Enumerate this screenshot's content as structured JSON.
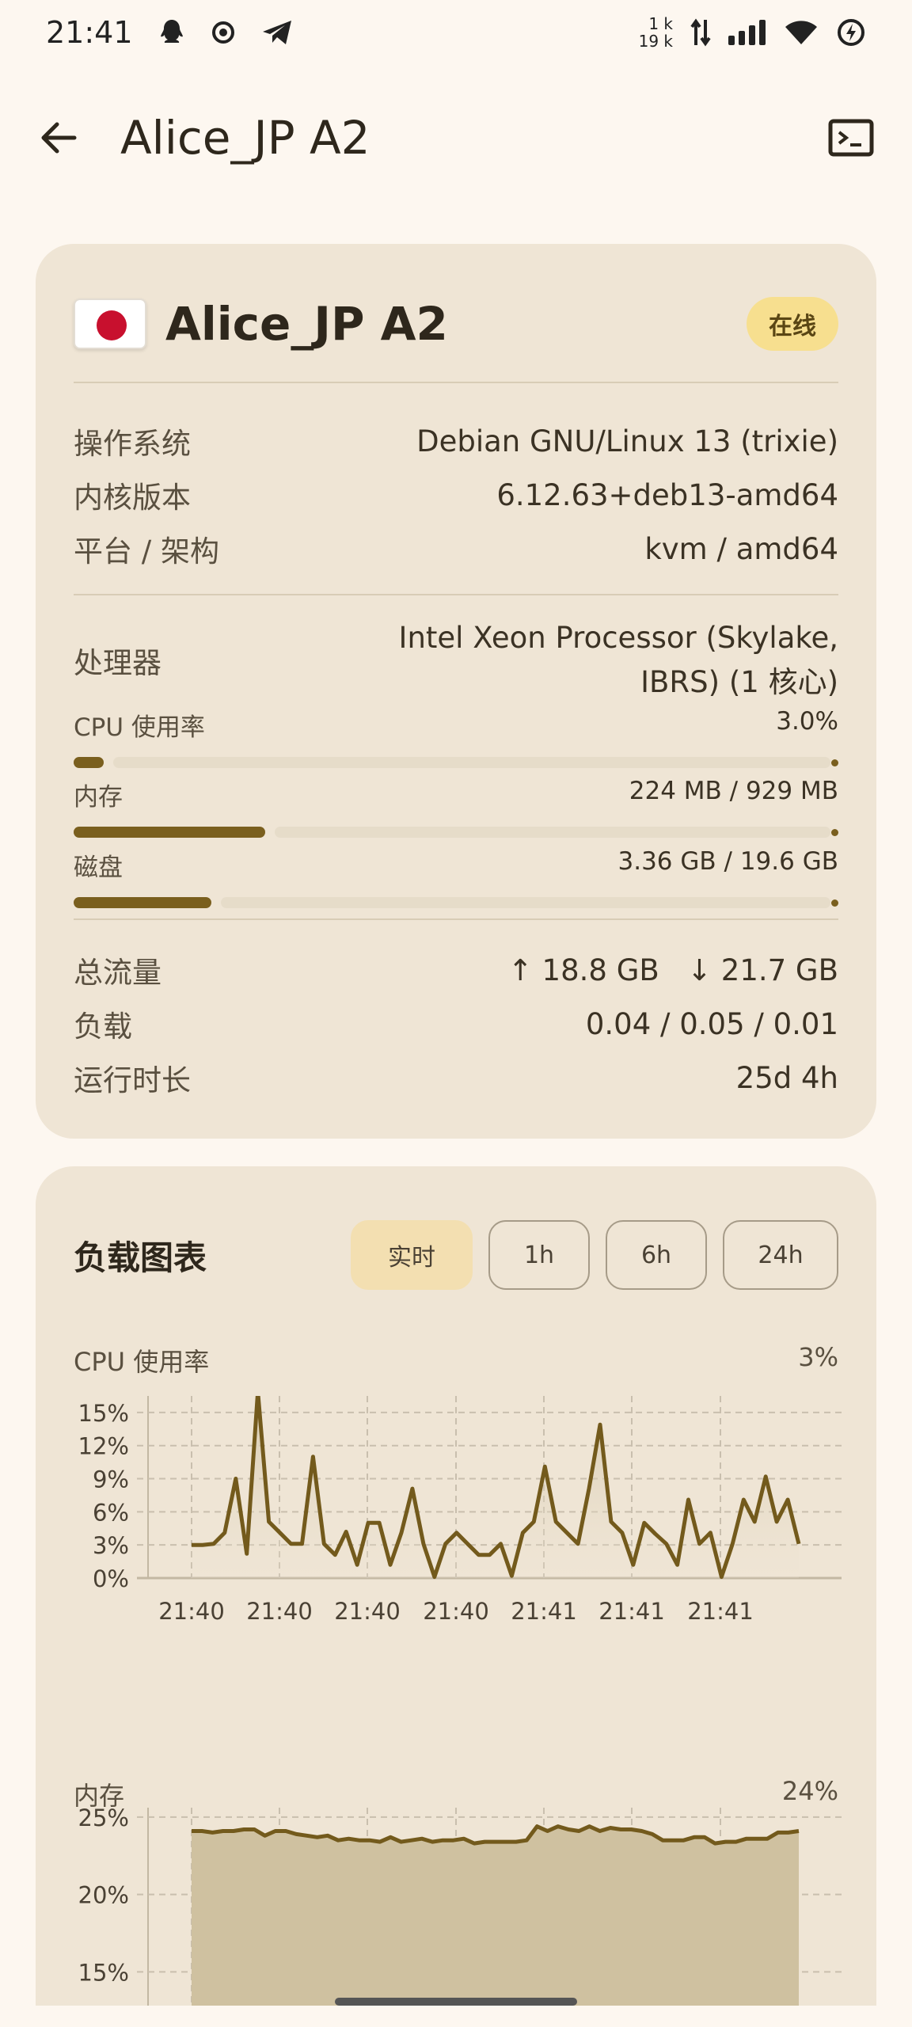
{
  "status_bar": {
    "time": "21:41",
    "net_up": "1 k",
    "net_down": "19 k"
  },
  "top_bar": {
    "title": "Alice_JP A2",
    "back_icon": "arrow-back-icon",
    "terminal_icon": "terminal-icon"
  },
  "server": {
    "flag": "jp-flag-icon",
    "name": "Alice_JP A2",
    "status": "在线",
    "info": [
      {
        "label": "操作系统",
        "value": "Debian GNU/Linux 13 (trixie)"
      },
      {
        "label": "内核版本",
        "value": "6.12.63+deb13-amd64"
      },
      {
        "label": "平台 / 架构",
        "value": "kvm / amd64"
      }
    ],
    "cpu_model": {
      "label": "处理器",
      "value_line1": "Intel Xeon Processor (Skylake,",
      "value_line2": "IBRS) (1 核心)"
    },
    "usage": [
      {
        "label": "CPU 使用率",
        "value": "3.0%",
        "fraction": 0.03
      },
      {
        "label": "内存",
        "value": "224 MB / 929 MB",
        "fraction": 0.241
      },
      {
        "label": "磁盘",
        "value": "3.36 GB / 19.6 GB",
        "fraction": 0.171
      }
    ],
    "stats": [
      {
        "label": "总流量",
        "value": "↑ 18.8 GB   ↓ 21.7 GB"
      },
      {
        "label": "负载",
        "value": "0.04 / 0.05 / 0.01"
      },
      {
        "label": "运行时长",
        "value": "25d 4h"
      }
    ]
  },
  "charts_card": {
    "title": "负载图表",
    "ranges": [
      "实时",
      "1h",
      "6h",
      "24h"
    ],
    "active_range": "实时"
  },
  "chart_data": [
    {
      "type": "line",
      "title": "CPU 使用率",
      "current": "3%",
      "y_ticks": [
        "0%",
        "3%",
        "6%",
        "9%",
        "12%",
        "15%"
      ],
      "ylim": [
        0,
        16.5
      ],
      "x_ticks": [
        "21:40",
        "21:40",
        "21:40",
        "21:40",
        "21:41",
        "21:41",
        "21:41"
      ],
      "grid": true,
      "values": [
        3,
        3,
        3.1,
        4.1,
        9,
        2.2,
        16.9,
        5.1,
        4.1,
        3.1,
        3.1,
        11,
        3.1,
        2.1,
        4.2,
        1.2,
        5,
        5,
        1.2,
        4.1,
        8.1,
        3.1,
        0.1,
        3.1,
        4.1,
        3.1,
        2.1,
        2.1,
        3.1,
        0.2,
        4.1,
        5.1,
        10.1,
        5.1,
        4.1,
        3.1,
        8.1,
        13.9,
        5.1,
        4.1,
        1.2,
        5,
        4,
        3.1,
        1.2,
        7.1,
        3.1,
        4.1,
        0.1,
        3.1,
        7.1,
        5.1,
        9.2,
        5.1,
        7.1,
        3.1
      ]
    },
    {
      "type": "area",
      "title": "内存",
      "current": "24%",
      "y_ticks": [
        "15%",
        "20%",
        "25%"
      ],
      "ylim": [
        14.2,
        25.3
      ],
      "grid": true,
      "values": [
        24.1,
        24.1,
        24,
        24.1,
        24.1,
        24.2,
        24.2,
        23.8,
        24.1,
        24.1,
        23.9,
        23.8,
        23.7,
        23.8,
        23.5,
        23.6,
        23.5,
        23.5,
        23.4,
        23.7,
        23.4,
        23.5,
        23.6,
        23.4,
        23.5,
        23.5,
        23.6,
        23.3,
        23.4,
        23.4,
        23.4,
        23.4,
        23.5,
        24.4,
        24.1,
        24.4,
        24.2,
        24.1,
        24.4,
        24.1,
        24.3,
        24.2,
        24.2,
        24.1,
        23.9,
        23.5,
        23.5,
        23.5,
        23.7,
        23.7,
        23.3,
        23.4,
        23.4,
        23.6,
        23.6,
        23.6,
        24,
        24,
        24.1
      ]
    }
  ]
}
